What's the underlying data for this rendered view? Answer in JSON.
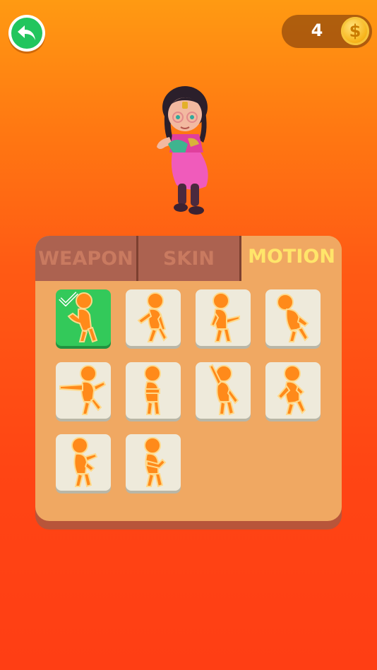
{
  "header": {
    "back_icon": "back-arrow-icon",
    "coins": "4",
    "coin_symbol": "$",
    "coin_icon": "gold-coin-icon"
  },
  "preview": {
    "character_icon": "dancing-girl-character"
  },
  "tabs": [
    {
      "label": "WEAPON",
      "active": false
    },
    {
      "label": "SKIN",
      "active": false
    },
    {
      "label": "MOTION",
      "active": true
    }
  ],
  "motions": [
    {
      "icon": "dance-pose-1-icon",
      "selected": true
    },
    {
      "icon": "dance-pose-2-icon",
      "selected": false
    },
    {
      "icon": "dance-pose-3-icon",
      "selected": false
    },
    {
      "icon": "dance-pose-4-icon",
      "selected": false
    },
    {
      "icon": "dance-pose-5-icon",
      "selected": false
    },
    {
      "icon": "dance-pose-6-icon",
      "selected": false
    },
    {
      "icon": "dance-pose-7-icon",
      "selected": false
    },
    {
      "icon": "dance-pose-8-icon",
      "selected": false
    },
    {
      "icon": "dance-pose-9-icon",
      "selected": false
    },
    {
      "icon": "dance-pose-10-icon",
      "selected": false
    }
  ],
  "colors": {
    "selected_slot": "#33c95a",
    "active_tab_text": "#ffe56a",
    "inactive_tab_text": "#c97a60",
    "figure": "#ff8a1a"
  }
}
